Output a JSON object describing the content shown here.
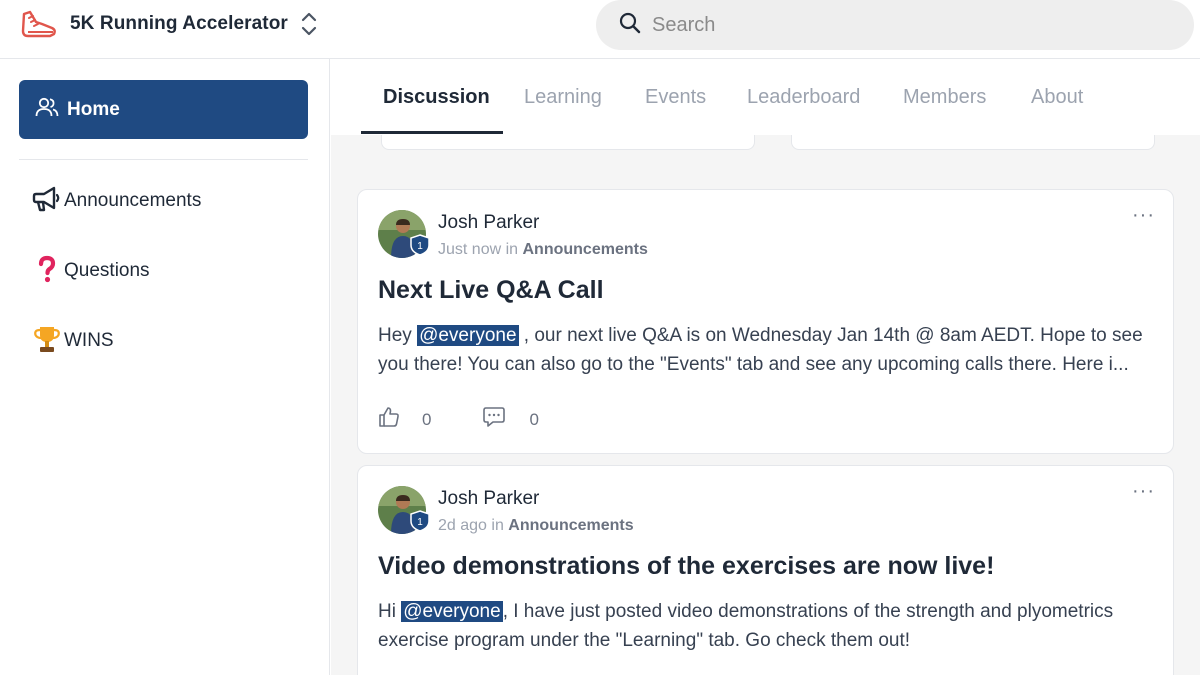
{
  "app": {
    "name": "5K Running Accelerator",
    "logo_icon": "running-shoe-icon",
    "accent": "#1f4a82",
    "logo_color": "#e0564c"
  },
  "search": {
    "placeholder": "Search"
  },
  "sidebar": {
    "home_label": "Home",
    "items": [
      {
        "label": "Announcements",
        "icon": "megaphone-icon"
      },
      {
        "label": "Questions",
        "icon": "question-mark-icon"
      },
      {
        "label": "WINS",
        "icon": "trophy-icon"
      }
    ]
  },
  "tabs": [
    "Discussion",
    "Learning",
    "Events",
    "Leaderboard",
    "Members",
    "About"
  ],
  "active_tab": "Discussion",
  "posts": [
    {
      "author": "Josh Parker",
      "level": "1",
      "time": "Just now",
      "in_text": "in",
      "category": "Announcements",
      "title": "Next Live Q&A Call",
      "body_before": "Hey ",
      "mention": "@everyone",
      "body_after": " , our next live Q&A is on Wednesday Jan 14th @ 8am AEDT. Hope to see you there! You can also go to the \"Events\" tab and see any upcoming calls there. Here i...",
      "likes": "0",
      "comments": "0"
    },
    {
      "author": "Josh Parker",
      "level": "1",
      "time": "2d ago",
      "in_text": "in",
      "category": "Announcements",
      "title": "Video demonstrations of the exercises are now live!",
      "body_before": "Hi ",
      "mention": "@everyone",
      "body_after": ", I have just posted video demonstrations of the strength and plyometrics exercise program under the \"Learning\" tab. Go check them out!"
    }
  ],
  "more_label": "···"
}
